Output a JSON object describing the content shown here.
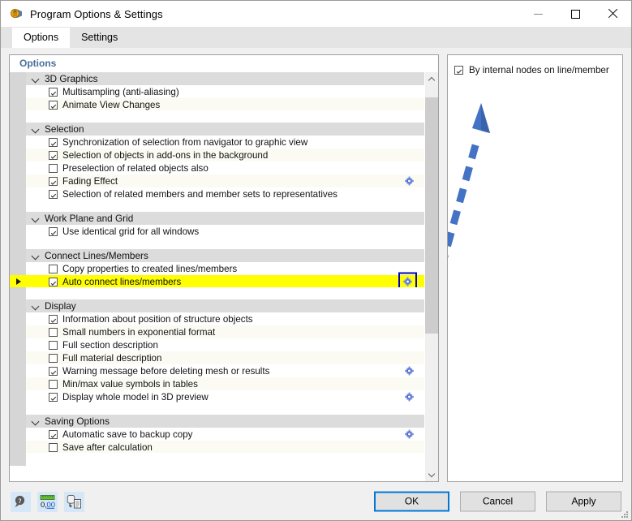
{
  "window": {
    "title": "Program Options & Settings",
    "icon": "options-lock-icon",
    "minimize_label": "Minimize",
    "maximize_label": "Maximize",
    "close_label": "Close"
  },
  "tabs": [
    {
      "label": "Options",
      "active": true
    },
    {
      "label": "Settings",
      "active": false
    }
  ],
  "left_pane": {
    "header": "Options",
    "rows": [
      {
        "kind": "group",
        "label": "3D Graphics"
      },
      {
        "kind": "item",
        "label": "Multisampling (anti-aliasing)",
        "checked": true,
        "gear": false,
        "band": "a"
      },
      {
        "kind": "item",
        "label": "Animate View Changes",
        "checked": true,
        "gear": false,
        "band": "b"
      },
      {
        "kind": "spacer",
        "label": ""
      },
      {
        "kind": "group",
        "label": "Selection"
      },
      {
        "kind": "item",
        "label": "Synchronization of selection from navigator to graphic view",
        "checked": true,
        "gear": false,
        "band": "a"
      },
      {
        "kind": "item",
        "label": "Selection of objects in add-ons in the background",
        "checked": true,
        "gear": false,
        "band": "b"
      },
      {
        "kind": "item",
        "label": "Preselection of related objects also",
        "checked": false,
        "gear": false,
        "band": "a"
      },
      {
        "kind": "item",
        "label": "Fading Effect",
        "checked": true,
        "gear": true,
        "band": "b"
      },
      {
        "kind": "item",
        "label": "Selection of related members and member sets to representatives",
        "checked": true,
        "gear": false,
        "band": "a"
      },
      {
        "kind": "spacer",
        "label": ""
      },
      {
        "kind": "group",
        "label": "Work Plane and Grid"
      },
      {
        "kind": "item",
        "label": "Use identical grid for all windows",
        "checked": true,
        "gear": false,
        "band": "a"
      },
      {
        "kind": "spacer",
        "label": ""
      },
      {
        "kind": "group",
        "label": "Connect Lines/Members"
      },
      {
        "kind": "item",
        "label": "Copy properties to created lines/members",
        "checked": false,
        "gear": false,
        "band": "a"
      },
      {
        "kind": "item",
        "label": "Auto connect lines/members",
        "checked": true,
        "gear": true,
        "band": "b",
        "highlighted": true,
        "expander": true,
        "gear_boxed": true
      },
      {
        "kind": "spacer",
        "label": ""
      },
      {
        "kind": "group",
        "label": "Display"
      },
      {
        "kind": "item",
        "label": "Information about position of structure objects",
        "checked": true,
        "gear": false,
        "band": "a"
      },
      {
        "kind": "item",
        "label": "Small numbers in exponential format",
        "checked": false,
        "gear": false,
        "band": "b"
      },
      {
        "kind": "item",
        "label": "Full section description",
        "checked": false,
        "gear": false,
        "band": "a"
      },
      {
        "kind": "item",
        "label": "Full material description",
        "checked": false,
        "gear": false,
        "band": "b"
      },
      {
        "kind": "item",
        "label": "Warning message before deleting mesh or results",
        "checked": true,
        "gear": true,
        "band": "a"
      },
      {
        "kind": "item",
        "label": "Min/max value symbols in tables",
        "checked": false,
        "gear": false,
        "band": "b"
      },
      {
        "kind": "item",
        "label": "Display whole model in 3D preview",
        "checked": true,
        "gear": true,
        "band": "a"
      },
      {
        "kind": "spacer",
        "label": ""
      },
      {
        "kind": "group",
        "label": "Saving Options"
      },
      {
        "kind": "item",
        "label": "Automatic save to backup copy",
        "checked": true,
        "gear": true,
        "band": "a"
      },
      {
        "kind": "item",
        "label": "Save after calculation",
        "checked": false,
        "gear": false,
        "band": "b"
      },
      {
        "kind": "spacer",
        "label": ""
      }
    ],
    "scrollbar": {
      "up_label": "Scroll up",
      "down_label": "Scroll down",
      "thumb_top_pct": 3,
      "thumb_height_pct": 62
    }
  },
  "right_pane": {
    "option": {
      "label": "By internal nodes on line/member",
      "checked": true
    },
    "annotation": {
      "type": "dashed-arrow",
      "color": "#4472C4"
    }
  },
  "footer": {
    "tools": [
      {
        "name": "help-icon",
        "title": "Help"
      },
      {
        "name": "units-icon",
        "title": "Units and Decimal Places",
        "text": "0,00"
      },
      {
        "name": "database-icon",
        "title": "Save as Default"
      }
    ],
    "buttons": [
      {
        "label": "OK",
        "default": true
      },
      {
        "label": "Cancel",
        "default": false
      },
      {
        "label": "Apply",
        "default": false
      }
    ]
  },
  "colors": {
    "highlight": "#ffff00",
    "focus_box": "#0404b4",
    "accent_button": "#0078d7",
    "arrow": "#4472C4",
    "header_text": "#4a6f9b"
  }
}
